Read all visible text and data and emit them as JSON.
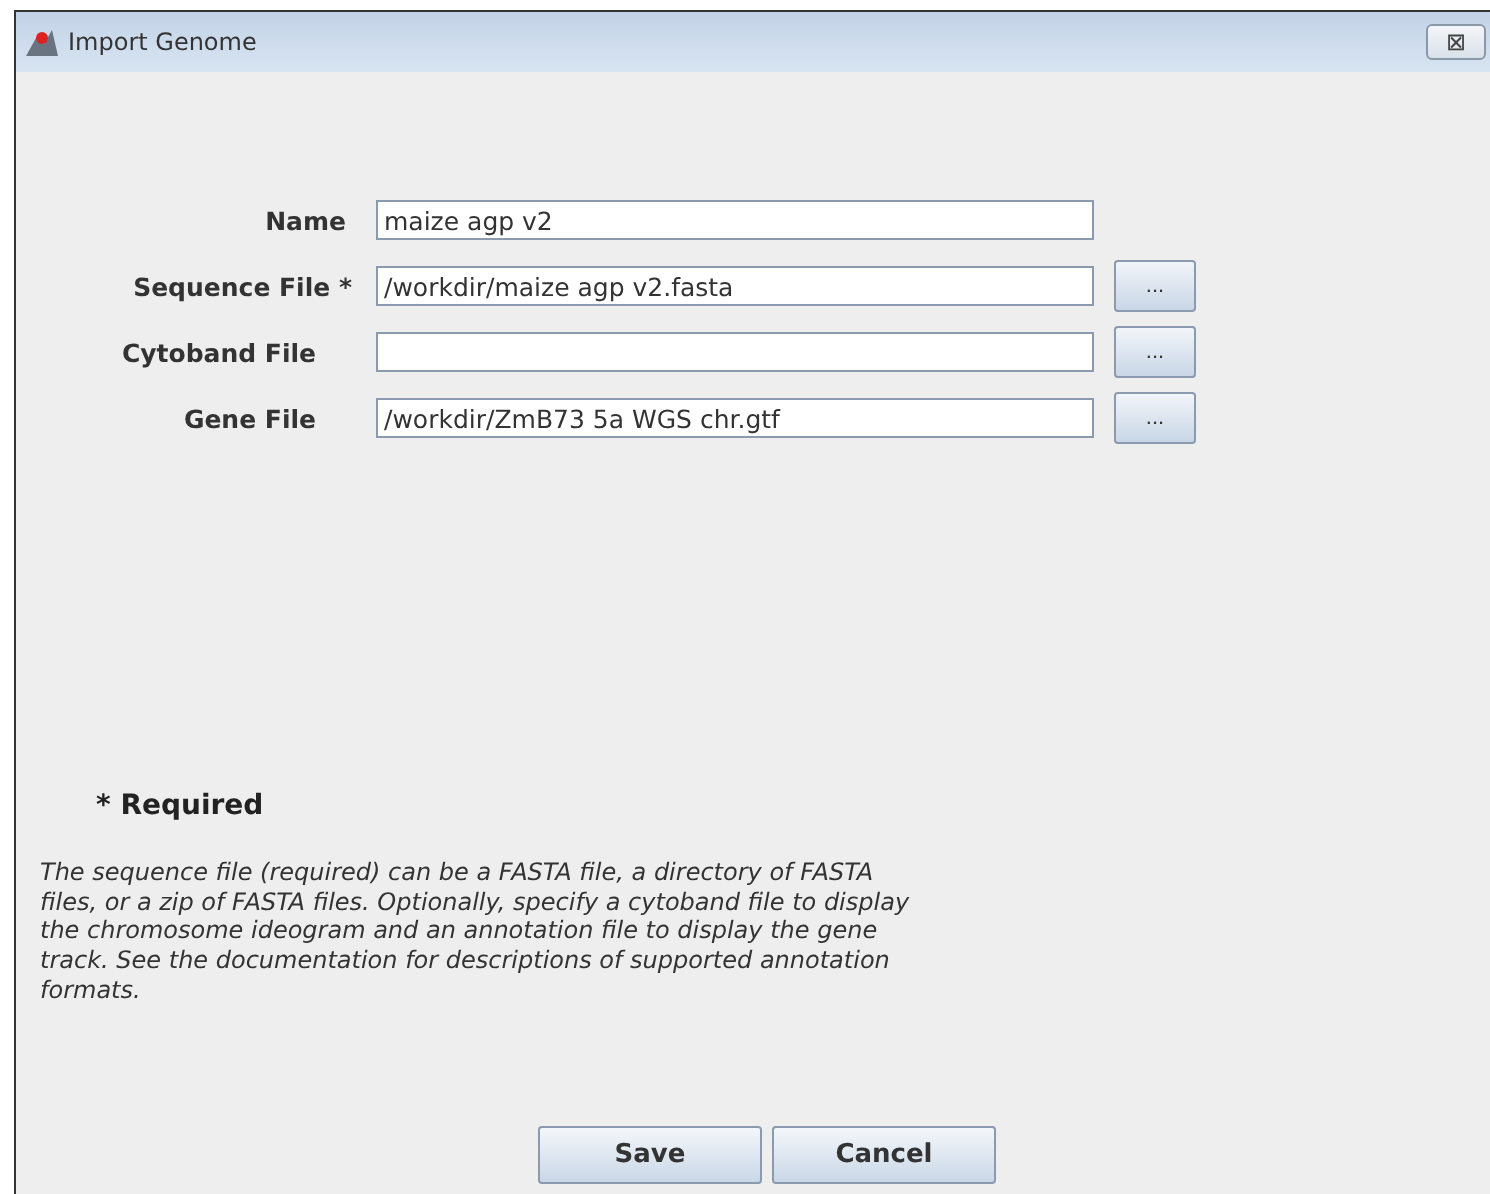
{
  "window": {
    "title": "Import Genome",
    "close": "⊠"
  },
  "fields": [
    {
      "label": "Name",
      "value": "maize agp v2",
      "browse": false
    },
    {
      "label": "Sequence File *",
      "value": "/workdir/maize agp v2.fasta",
      "browse": true,
      "browse_label": "..."
    },
    {
      "label": "Cytoband File",
      "browse": true,
      "browse_label": "..."
    },
    {
      "label": "Gene File",
      "value": "/workdir/ZmB73 5a WGS chr.gtf",
      "browse": true,
      "browse_label": "..."
    }
  ],
  "required_note": "* Required",
  "help_text": "The sequence file (required) can be a FASTA file, a directory of FASTA files, or a zip of FASTA files. Optionally, specify a cytoband file to display the chromosome ideogram and an annotation file to display the gene track. See the documentation for descriptions of supported annotation formats.",
  "buttons": [
    "Save",
    "Cancel"
  ]
}
